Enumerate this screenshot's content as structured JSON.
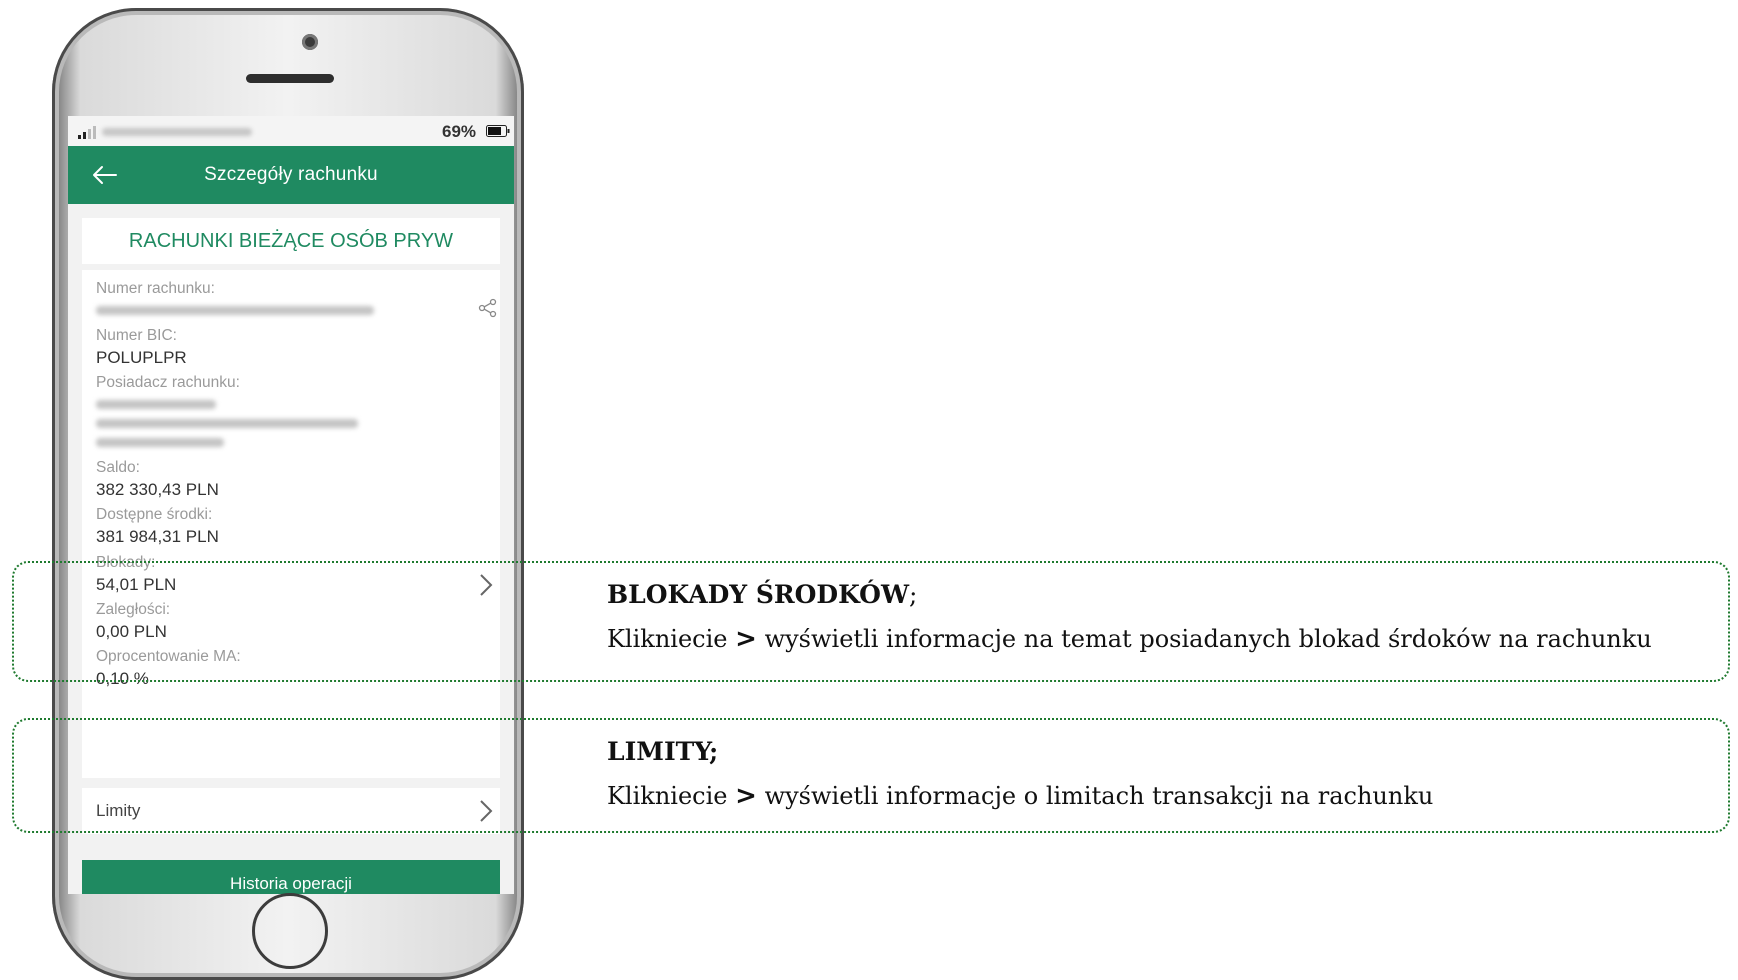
{
  "status_bar": {
    "battery_percent": "69%"
  },
  "header": {
    "title": "Szczegóły rachunku",
    "back_icon": "arrow-left-icon"
  },
  "account_type": "RACHUNKI BIEŻĄCE OSÓB PRYW",
  "details": {
    "account_number_label": "Numer rachunku:",
    "bic_label": "Numer BIC:",
    "bic_value": "POLUPLPR",
    "owner_label": "Posiadacz rachunku:",
    "balance_label": "Saldo:",
    "balance_value": "382 330,43 PLN",
    "available_label": "Dostępne środki:",
    "available_value": "381 984,31 PLN",
    "blocks_label": "Blokady:",
    "blocks_value": "54,01 PLN",
    "arrears_label": "Zaległości:",
    "arrears_value": "0,00 PLN",
    "interest_label": "Oprocentowanie MA:",
    "interest_value": "0,10 %"
  },
  "limits": {
    "label": "Limity"
  },
  "history_button": "Historia operacji",
  "callouts": [
    {
      "title": "BLOKADY ŚRODKÓW",
      "title_suffix": ";",
      "text_before": "Klikniecie",
      "symbol": ">",
      "text_after": "wyświetli informacje na temat posiadanych blokad śrdoków na rachunku"
    },
    {
      "title": "LIMITY;",
      "text_before": "Klikniecie",
      "symbol": ">",
      "text_after": "wyświetli informacje o limitach transakcji na rachunku"
    }
  ],
  "colors": {
    "brand_green": "#1f8a61",
    "callout_border": "#1f7a2f"
  }
}
